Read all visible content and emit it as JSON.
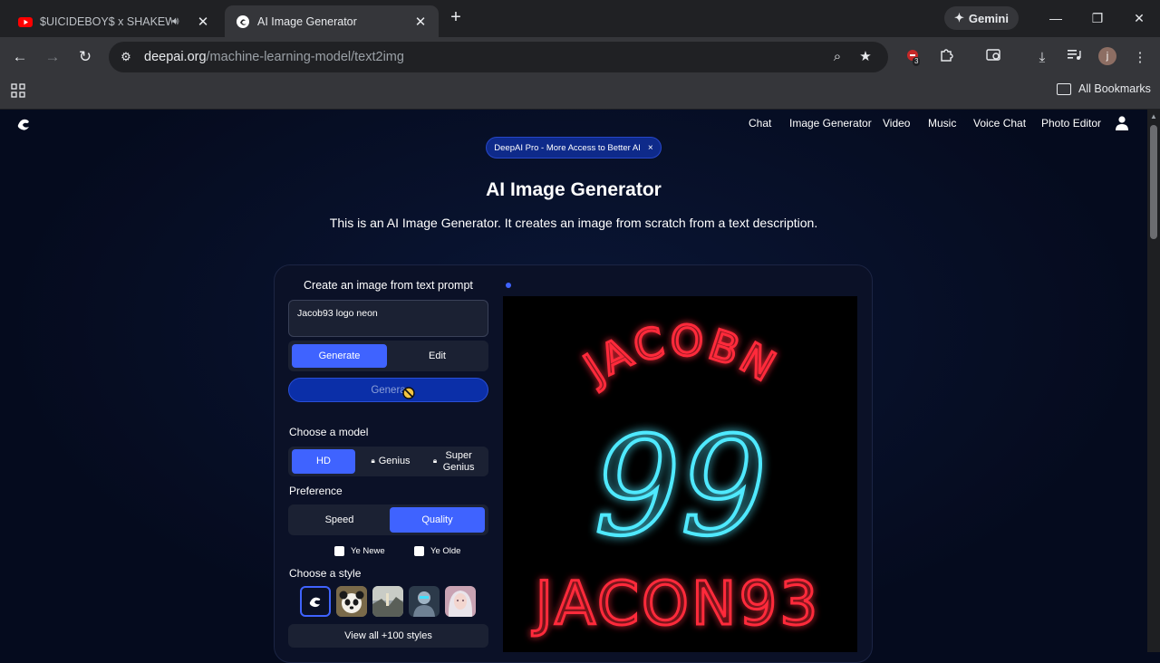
{
  "browser": {
    "tabs": [
      {
        "title": "$UICIDEBOY$ x SHAKEWELL",
        "active": false,
        "audio": true
      },
      {
        "title": "AI Image Generator",
        "active": true
      }
    ],
    "gemini_label": "Gemini",
    "url_host": "deepai.org",
    "url_path": "/machine-learning-model/text2img",
    "extension_badge": "3",
    "profile_initial": "j",
    "bookmarks_label": "All Bookmarks"
  },
  "site": {
    "nav": [
      "Chat",
      "Image Generator",
      "Video",
      "Music",
      "Voice Chat",
      "Photo Editor"
    ],
    "promo": "DeepAI Pro - More Access to Better AI",
    "promo_close": "×",
    "title": "AI Image Generator",
    "subtitle": "This is an AI Image Generator. It creates an image from scratch from a text description."
  },
  "generator": {
    "panel_title": "Create an image from text prompt",
    "prompt_value": "Jacob93  logo neon",
    "mode_tabs": [
      "Generate",
      "Edit"
    ],
    "generate_button": "Genera",
    "model_label": "Choose a model",
    "models": [
      "HD",
      "Genius",
      "Super Genius"
    ],
    "preference_label": "Preference",
    "preferences": [
      "Speed",
      "Quality"
    ],
    "checkboxes": [
      "Ye Newe",
      "Ye Olde"
    ],
    "style_label": "Choose a style",
    "view_all": "View all +100 styles"
  },
  "result_image": {
    "line1": "JACOBN",
    "line2": "99",
    "line3": "JACON93"
  },
  "colors": {
    "accent": "#3f63ff",
    "neon_red": "#ff2a3a",
    "neon_cyan": "#4fe9ff"
  }
}
